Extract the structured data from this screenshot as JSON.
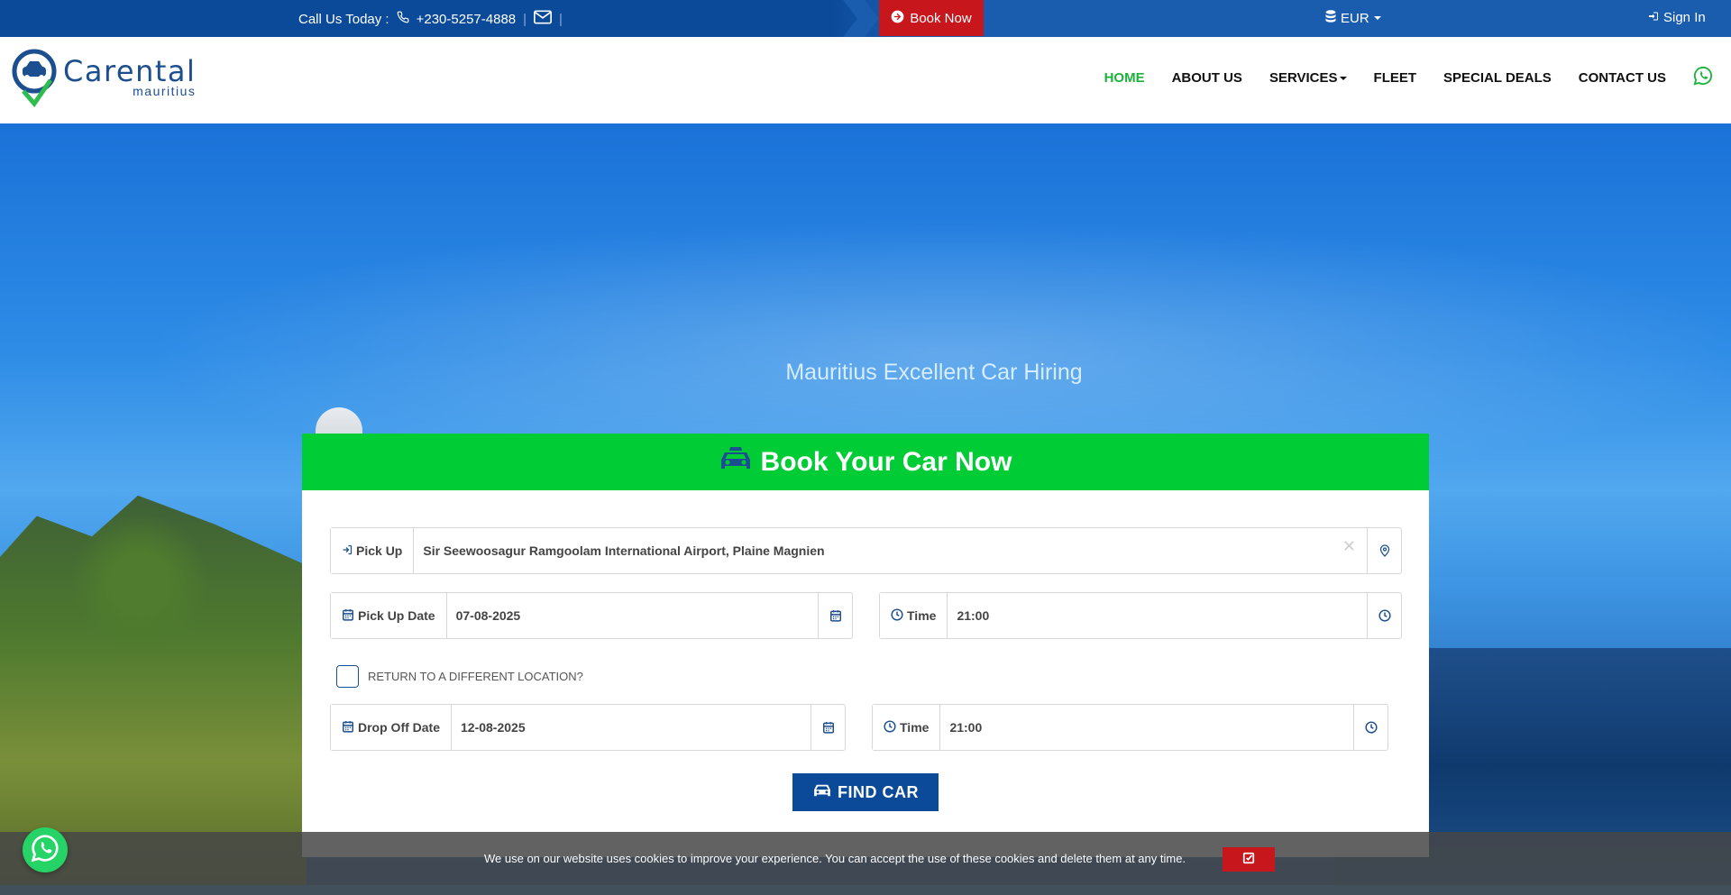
{
  "topbar": {
    "call_label": "Call Us Today :",
    "phone": "+230-5257-4888",
    "book_now": "Book Now",
    "currency": "EUR",
    "sign_in": "Sign In"
  },
  "header": {
    "logo_name": "Carental",
    "logo_sub": "mauritius",
    "nav": [
      "HOME",
      "ABOUT US",
      "SERVICES",
      "FLEET",
      "SPECIAL DEALS",
      "CONTACT US"
    ]
  },
  "hero": {
    "title": "Mauritius Excellent Car Hiring"
  },
  "booking": {
    "heading": "Book Your Car Now",
    "pickup_label": "Pick Up",
    "pickup_value": "Sir Seewoosagur Ramgoolam International Airport, Plaine Magnien",
    "pickup_date_label": "Pick Up Date",
    "pickup_date_value": "07-08-2025",
    "pickup_time_label": "Time",
    "pickup_time_value": "21:00",
    "return_label": "RETURN TO A DIFFERENT LOCATION?",
    "dropoff_date_label": "Drop Off Date",
    "dropoff_date_value": "12-08-2025",
    "dropoff_time_label": "Time",
    "dropoff_time_value": "21:00",
    "find_car": "FIND CAR"
  },
  "cookie": {
    "text": "We use on our website uses cookies to improve your experience. You can accept the use of these cookies and delete them at any time."
  },
  "colors": {
    "topbar": "#0b4a99",
    "book_now": "#c8161d",
    "nav_active": "#1ab33c",
    "panel_head": "#00cc36",
    "find_button": "#0b4a99",
    "whatsapp": "#25d366"
  }
}
